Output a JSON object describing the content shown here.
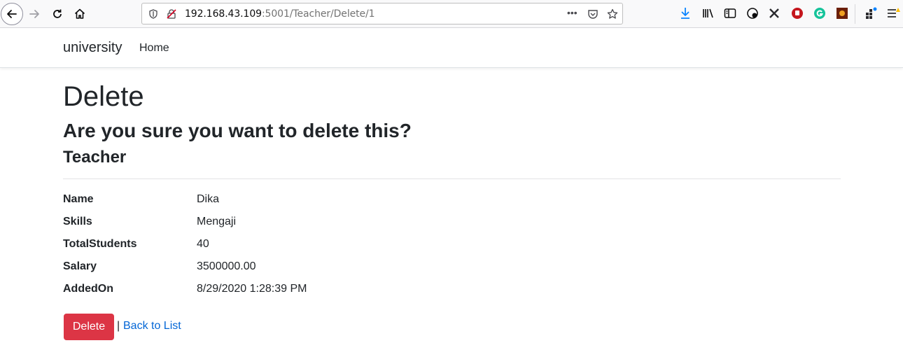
{
  "browser": {
    "url_host": "192.168.43.109",
    "url_rest": ":5001/Teacher/Delete/1",
    "more_label": "•••",
    "accent": "#0a84ff"
  },
  "navbar": {
    "brand": "university",
    "home": "Home"
  },
  "page": {
    "title": "Delete",
    "question": "Are you sure you want to delete this?",
    "entity": "Teacher"
  },
  "details": [
    {
      "label": "Name",
      "value": "Dika"
    },
    {
      "label": "Skills",
      "value": "Mengaji"
    },
    {
      "label": "TotalStudents",
      "value": "40"
    },
    {
      "label": "Salary",
      "value": "3500000.00"
    },
    {
      "label": "AddedOn",
      "value": "8/29/2020 1:28:39 PM"
    }
  ],
  "actions": {
    "delete_label": "Delete",
    "separator": "|",
    "back_label": "Back to List",
    "delete_color": "#dc3545",
    "link_color": "#0366d6"
  },
  "icons": [
    "back-icon",
    "forward-icon",
    "reload-icon",
    "home-icon",
    "shield-icon",
    "insecure-lock-icon",
    "pocket-icon",
    "star-icon",
    "download-icon",
    "library-icon",
    "sidebar-icon",
    "extension-icon",
    "x-icon",
    "ublock-icon",
    "grammarly-icon",
    "addon-icon",
    "apps-icon",
    "menu-icon"
  ]
}
